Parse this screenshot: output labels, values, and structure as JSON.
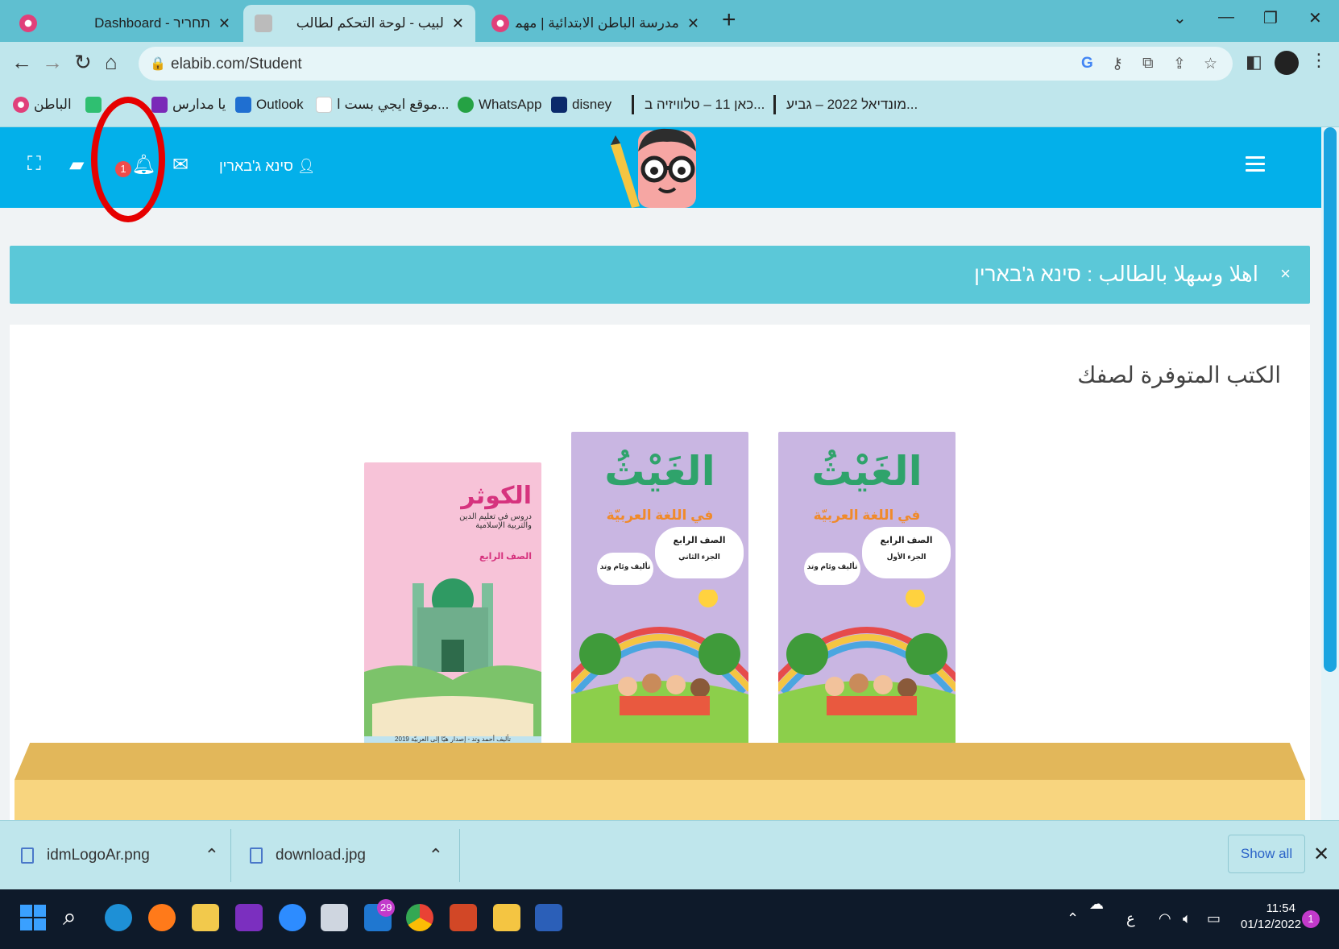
{
  "browser": {
    "tabs": [
      {
        "title": "תחריר - Dashboard",
        "close": "✕"
      },
      {
        "title": "لبيب - لوحة التحكم لطالب",
        "close": "✕"
      },
      {
        "title": "مدرسة الباطن الابتدائية | مهمة دين",
        "close": "✕"
      }
    ],
    "new_tab": "+",
    "window_controls": {
      "dropdown": "⌄",
      "minimize": "—",
      "restore": "❐",
      "close": "✕"
    },
    "url": "elabib.com/Student",
    "bookmarks": [
      {
        "label": "الباطن",
        "icon": "flower-icon",
        "color": "#e0407a"
      },
      {
        "label": "",
        "icon": "green-chat-icon",
        "color": "#2fbf71"
      },
      {
        "label": "يا مدارس",
        "icon": "yahoo-icon",
        "color": "#7a2ab8"
      },
      {
        "label": "Outlook",
        "icon": "outlook-icon",
        "color": "#1f6fd1"
      },
      {
        "label": "موقع ايجي بست ا...",
        "icon": "egybest-icon",
        "color": "#ffffff"
      },
      {
        "label": "WhatsApp",
        "icon": "whatsapp-icon",
        "color": "#25a244"
      },
      {
        "label": "disney",
        "icon": "disney-icon",
        "color": "#0b2a6b"
      },
      {
        "label": "כאן 11 – טלוויזיה ב...",
        "icon": "kan-icon",
        "color": "#111111"
      },
      {
        "label": "מונדיאל 2022 – גביע...",
        "icon": "mondial-icon",
        "color": "#111111"
      }
    ]
  },
  "site": {
    "user_name": "סינא ג'בארין",
    "notification_count": "1",
    "welcome_message": "اهلا وسهلا بالطالب : סינא ג'בארין",
    "welcome_close": "×",
    "books_title": "الكتب المتوفرة لصفك",
    "books": [
      {
        "title": "الكوثر",
        "subtitle": "دروس في تعليم الدين والتربية الإسلامية",
        "grade": "الصف الرابع",
        "footer": "تأليف أحمد وتد - إصدار هيّا إلى العربيّة 2019",
        "color": "#f7c3d8"
      },
      {
        "title": "الغَيْثُ",
        "subtitle": "في اللغة العربيّة",
        "grade": "الصف الرابع",
        "part": "الجزء الثاني",
        "author": "تأليف وئام وتد",
        "color": "#c9b6e2"
      },
      {
        "title": "الغَيْثُ",
        "subtitle": "في اللغة العربيّة",
        "grade": "الصف الرابع",
        "part": "الجزء الأول",
        "author": "تأليف وئام وتد",
        "color": "#c9b6e2"
      }
    ]
  },
  "downloads": {
    "items": [
      {
        "name": "idmLogoAr.png",
        "chevron": "⌃"
      },
      {
        "name": "download.jpg",
        "chevron": "⌃"
      }
    ],
    "show_all": "Show all",
    "close": "✕"
  },
  "taskbar": {
    "apps": [
      {
        "name": "start",
        "color": "#3aa0ff"
      },
      {
        "name": "search",
        "color": "#0e1a2a"
      },
      {
        "name": "edge",
        "color": "#1e90d6"
      },
      {
        "name": "firefox",
        "color": "#ff7a1a"
      },
      {
        "name": "files",
        "color": "#f2c94c"
      },
      {
        "name": "onenote",
        "color": "#7b2fbf"
      },
      {
        "name": "zoom",
        "color": "#2d8cff"
      },
      {
        "name": "printer",
        "color": "#cfd6e0"
      },
      {
        "name": "mail",
        "color": "#1f77d0"
      },
      {
        "name": "chrome",
        "color": "#e94235"
      },
      {
        "name": "powerpoint",
        "color": "#d24726"
      },
      {
        "name": "explorer",
        "color": "#f4c542"
      },
      {
        "name": "word",
        "color": "#2b5fb8"
      }
    ],
    "mail_badge": "29",
    "keyboard_lang": "ع",
    "time": "11:54",
    "date": "01/12/2022",
    "notification_count": "1"
  }
}
